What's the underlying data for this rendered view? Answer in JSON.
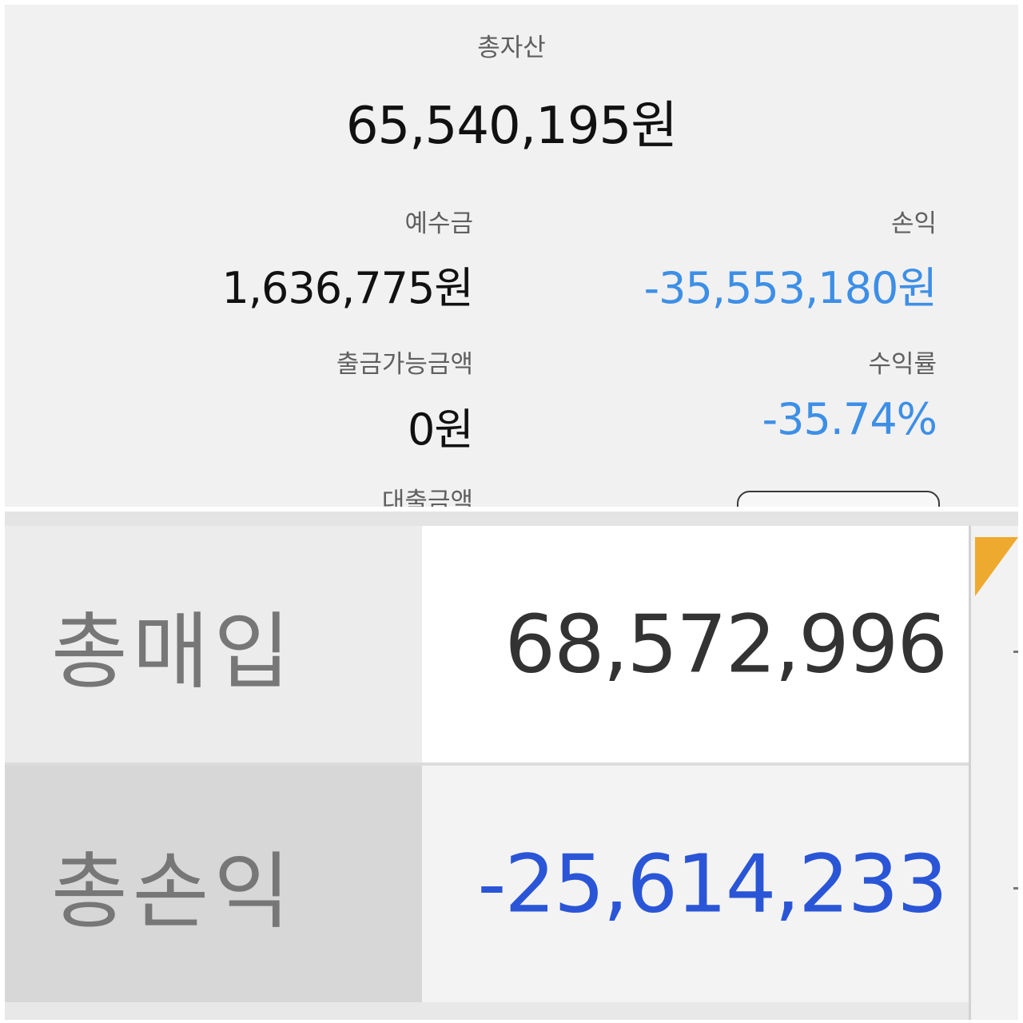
{
  "top_panel": {
    "total_assets_label": "총자산",
    "total_assets_value": "65,540,195원",
    "deposit_label": "예수금",
    "deposit_value": "1,636,775원",
    "profit_loss_label": "손익",
    "profit_loss_value": "-35,553,180원",
    "withdrawable_label": "출금가능금액",
    "withdrawable_value": "0원",
    "return_rate_label": "수익률",
    "return_rate_value": "-35.74%",
    "loan_label": "대출금액"
  },
  "bottom_panel": {
    "rows": [
      {
        "label": "총매입",
        "value": "68,572,996"
      },
      {
        "label": "총손익",
        "value": "-25,614,233"
      }
    ]
  },
  "colors": {
    "negative_top": "#3d8fe6",
    "negative_bottom": "#2a55d6",
    "accent_flag": "#eeaa2f"
  }
}
